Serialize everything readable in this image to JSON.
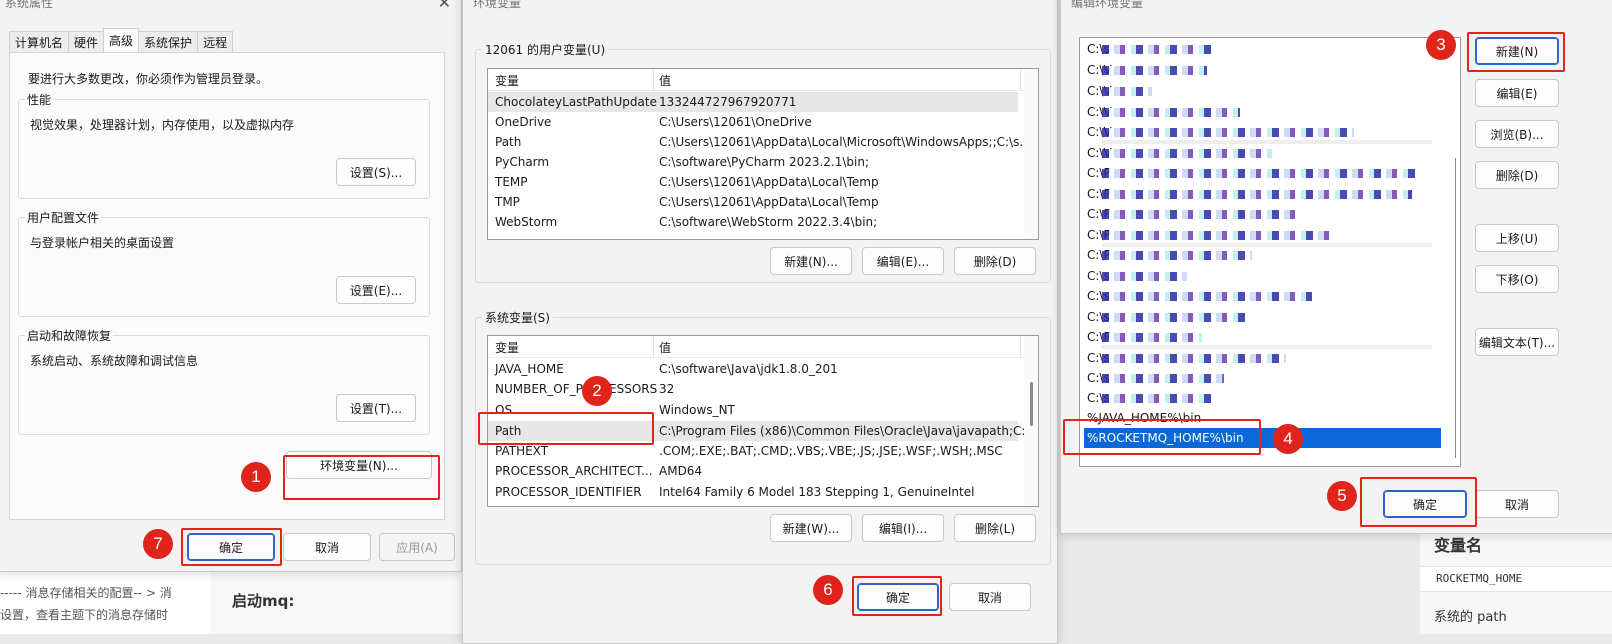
{
  "win1": {
    "title": "系统属性",
    "tabs": [
      "计算机名",
      "硬件",
      "高级",
      "系统保护",
      "远程"
    ],
    "admin_note": "要进行大多数更改，你必须作为管理员登录。",
    "perf": {
      "title": "性能",
      "desc": "视觉效果，处理器计划，内存使用，以及虚拟内存",
      "btn": "设置(S)..."
    },
    "profile": {
      "title": "用户配置文件",
      "desc": "与登录帐户相关的桌面设置",
      "btn": "设置(E)..."
    },
    "startup": {
      "title": "启动和故障恢复",
      "desc": "系统启动、系统故障和调试信息",
      "btn": "设置(T)..."
    },
    "env_btn": "环境变量(N)...",
    "ok": "确定",
    "cancel": "取消",
    "apply": "应用(A)"
  },
  "win2": {
    "title": "环境变量",
    "user_section": "12061 的用户变量(U)",
    "col_var": "变量",
    "col_val": "值",
    "user_vars": [
      {
        "name": "ChocolateyLastPathUpdate",
        "value": "133244727967920771"
      },
      {
        "name": "OneDrive",
        "value": "C:\\Users\\12061\\OneDrive"
      },
      {
        "name": "Path",
        "value": "C:\\Users\\12061\\AppData\\Local\\Microsoft\\WindowsApps;;C:\\s..."
      },
      {
        "name": "PyCharm",
        "value": "C:\\software\\PyCharm 2023.2.1\\bin;"
      },
      {
        "name": "TEMP",
        "value": "C:\\Users\\12061\\AppData\\Local\\Temp"
      },
      {
        "name": "TMP",
        "value": "C:\\Users\\12061\\AppData\\Local\\Temp"
      },
      {
        "name": "WebStorm",
        "value": "C:\\software\\WebStorm 2022.3.4\\bin;"
      }
    ],
    "user_btns": {
      "new": "新建(N)...",
      "edit": "编辑(E)...",
      "del": "删除(D)"
    },
    "sys_section": "系统变量(S)",
    "sys_vars": [
      {
        "name": "JAVA_HOME",
        "value": "C:\\software\\Java\\jdk1.8.0_201"
      },
      {
        "name": "NUMBER_OF_PROCESSORS",
        "value": "32"
      },
      {
        "name": "OS",
        "value": "Windows_NT"
      },
      {
        "name": "Path",
        "value": "C:\\Program Files (x86)\\Common Files\\Oracle\\Java\\javapath;C:..."
      },
      {
        "name": "PATHEXT",
        "value": ".COM;.EXE;.BAT;.CMD;.VBS;.VBE;.JS;.JSE;.WSF;.WSH;.MSC"
      },
      {
        "name": "PROCESSOR_ARCHITECT...",
        "value": "AMD64"
      },
      {
        "name": "PROCESSOR_IDENTIFIER",
        "value": "Intel64 Family 6 Model 183 Stepping 1, GenuineIntel"
      }
    ],
    "sys_btns": {
      "new": "新建(W)...",
      "edit": "编辑(I)...",
      "del": "删除(L)"
    },
    "ok": "确定",
    "cancel": "取消"
  },
  "win3": {
    "title": "编辑环境变量",
    "entries": [
      "C:\\s",
      "C:\\V",
      "C:\\V",
      "C:\\V",
      "C:\\V",
      "C:\\V",
      "C:\\P",
      "C:\\P",
      "C:\\P",
      "C:\\P",
      "C:\\P",
      "C:\\s",
      "C:\\s",
      "C:\\s",
      "C:\\P",
      "C:\\s",
      "C:\\s",
      "C:\\s"
    ],
    "java_entry": "%JAVA_HOME%\\bin",
    "rocket_entry": "%ROCKETMQ_HOME%\\bin",
    "btns": {
      "new": "新建(N)",
      "edit": "编辑(E)",
      "browse": "浏览(B)...",
      "delete": "删除(D)",
      "up": "上移(U)",
      "down": "下移(O)",
      "edit_text": "编辑文本(T)..."
    },
    "ok": "确定",
    "cancel": "取消"
  },
  "badges": [
    "1",
    "2",
    "3",
    "4",
    "5",
    "6",
    "7"
  ],
  "background": {
    "left_text1": "----- 消息存储相关的配置-- > 消",
    "left_text2": "设置，查看主题下的消息存储时",
    "heading": "启动mq:",
    "right_heading": "变量名",
    "right_code": "ROCKETMQ_HOME",
    "right_text": "系统的 path"
  },
  "colors": {
    "accent": "#0a68d8",
    "annotation": "#e3241b"
  }
}
